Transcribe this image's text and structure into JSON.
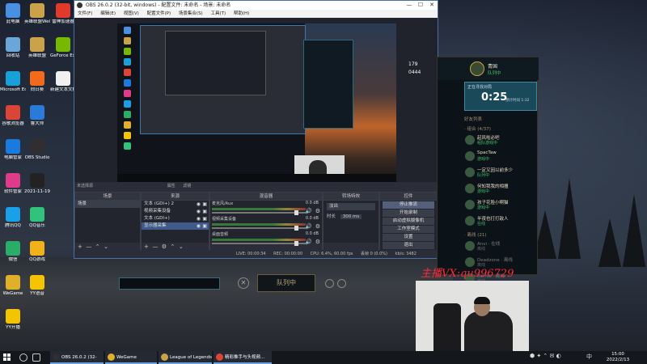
{
  "desktop": {
    "icons": [
      {
        "label": "此电脑",
        "color": "#4a90e2"
      },
      {
        "label": "英雄联盟WeGame版",
        "color": "#c9a24a"
      },
      {
        "label": "雷神加速器",
        "color": "#e23a2a"
      },
      {
        "label": "回收站",
        "color": "#6aa7d8"
      },
      {
        "label": "英雄联盟",
        "color": "#c9a24a"
      },
      {
        "label": "GeForce Experience",
        "color": "#76b900"
      },
      {
        "label": "Microsoft Edge",
        "color": "#1aa0d8"
      },
      {
        "label": "向日葵",
        "color": "#f26a1b"
      },
      {
        "label": "新建文本文档",
        "color": "#f0f0f0"
      },
      {
        "label": "谷歌浏览器",
        "color": "#db4437"
      },
      {
        "label": "鲁大师",
        "color": "#2a7ad8"
      },
      {
        "label": "",
        "color": "#2a2a2a"
      },
      {
        "label": "电脑管家",
        "color": "#1a7ae0"
      },
      {
        "label": "OBS Studio",
        "color": "#302e31"
      },
      {
        "label": "",
        "color": "#2a2a2a"
      },
      {
        "label": "软件管家",
        "color": "#e03a8a"
      },
      {
        "label": "2021-11-19 Team AIR...",
        "color": "#222"
      },
      {
        "label": "",
        "color": "#2a2a2a"
      },
      {
        "label": "腾讯QQ",
        "color": "#1aa0e8"
      },
      {
        "label": "QQ音乐",
        "color": "#31c27c"
      },
      {
        "label": "",
        "color": "#2a2a2a"
      },
      {
        "label": "微信",
        "color": "#2aae67"
      },
      {
        "label": "QQ游戏",
        "color": "#f0b21a"
      },
      {
        "label": "",
        "color": "#2a2a2a"
      },
      {
        "label": "WeGame",
        "color": "#e0b02a"
      },
      {
        "label": "YY语音",
        "color": "#f5c400"
      },
      {
        "label": "",
        "color": "#2a2a2a"
      },
      {
        "label": "YY开播",
        "color": "#f5c400"
      }
    ]
  },
  "obs": {
    "title": "OBS 26.0.2 (32-bit, windows) - 配置文件: 未命名 - 场景: 未命名",
    "window_buttons": {
      "min": "—",
      "max": "☐",
      "close": "✕"
    },
    "menu": [
      "文件(F)",
      "编辑(E)",
      "视图(V)",
      "配置文件(P)",
      "场景集合(S)",
      "工具(T)",
      "帮助(H)"
    ],
    "preview_status": "未选择源",
    "preview_props": "属性",
    "preview_filters": "滤镜",
    "docks": {
      "scenes": {
        "title": "场景",
        "items": [
          "场景"
        ]
      },
      "sources": {
        "title": "来源",
        "items": [
          {
            "label": "文本 (GDI+) 2",
            "selected": false
          },
          {
            "label": "视频采集设备",
            "selected": false
          },
          {
            "label": "文本 (GDI+)",
            "selected": false
          },
          {
            "label": "显示器采集",
            "selected": true
          }
        ]
      },
      "mixer": {
        "title": "混音器",
        "channels": [
          {
            "name": "麦克风/Aux",
            "db": "0.0 dB"
          },
          {
            "name": "视频采集设备",
            "db": "0.0 dB"
          },
          {
            "name": "桌面音频",
            "db": "0.0 dB"
          }
        ]
      },
      "transitions": {
        "title": "转场特效",
        "type": "淡出",
        "duration_label": "时长",
        "duration": "300 ms"
      },
      "controls": {
        "title": "控件",
        "buttons": [
          "停止推流",
          "开始录制",
          "启动虚拟摄像机",
          "工作室模式",
          "设置",
          "退出"
        ]
      }
    },
    "status": {
      "live": "LIVE: 00:00:34",
      "rec": "REC: 00:00:00",
      "cpu": "CPU: 6.4%, 60.00 fps",
      "frames": "丢帧 0 (0.0%)",
      "kbps": "kb/s: 3482"
    }
  },
  "lol_client": {
    "level_left": "179",
    "points_left": "0444",
    "player_name": "青国",
    "player_status": "队列中",
    "queue_title": "正在寻找对局",
    "queue_time": "0:25",
    "queue_estimate": "预计时间 1:32",
    "friends_header": "好友列表",
    "group_online": "· 组合 (4/37)",
    "friends": [
      {
        "name": "起风啦必吧",
        "status": "组队游戏中",
        "offline": false
      },
      {
        "name": "SpacTaw",
        "status": "游戏中",
        "offline": false
      },
      {
        "name": "一定又因以前多少",
        "status": "队列中",
        "offline": false
      },
      {
        "name": "何知我我的相擅",
        "status": "游戏中",
        "offline": false
      },
      {
        "name": "孩子花脸小啊猫",
        "status": "游戏中",
        "offline": false
      },
      {
        "name": "半夜也打打敌人",
        "status": "在线",
        "offline": false
      }
    ],
    "group_offline": "· 离线 (21)",
    "offline_friends": [
      {
        "name": "Anvi · 在线",
        "status": "离线",
        "offline": true
      },
      {
        "name": "Deadzone · 离线",
        "status": "离线",
        "offline": true
      },
      {
        "name": "Bernie · 离线",
        "status": "离线",
        "offline": true
      }
    ]
  },
  "lobby": {
    "button_label": "队列中"
  },
  "watermark": "主播VX:qu996729",
  "taskbar": {
    "apps": [
      {
        "label": "OBS 26.0.2 (32-bi...",
        "color": "#302e31"
      },
      {
        "label": "WeGame",
        "color": "#e0b02a"
      },
      {
        "label": "League of Legends",
        "color": "#c9a24a"
      },
      {
        "label": "精彩推手与头视频...",
        "color": "#db4437"
      }
    ],
    "ime": "中",
    "time": "15:00",
    "date": "2022/2/13"
  }
}
